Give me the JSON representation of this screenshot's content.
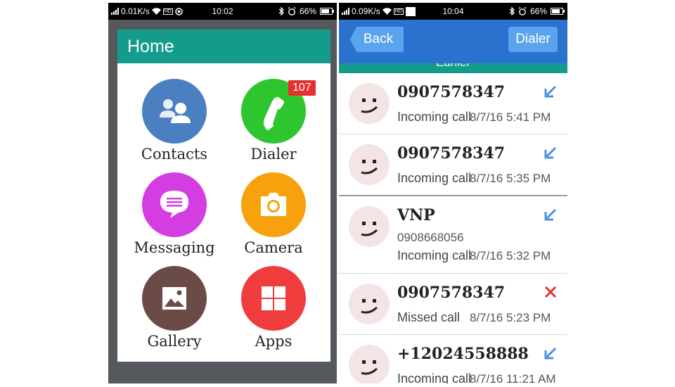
{
  "left_status": {
    "speed": "0.01K/s",
    "time": "10:02",
    "battery": "66%",
    "hd": "HD"
  },
  "right_status": {
    "speed": "0.09K/s",
    "time": "10:04",
    "battery": "66%",
    "hd": "HD"
  },
  "home": {
    "title": "Home",
    "apps": [
      {
        "label": "Contacts",
        "color": "#4a7fc1",
        "icon": "contacts-icon"
      },
      {
        "label": "Dialer",
        "color": "#2ec52e",
        "icon": "phone-icon",
        "badge": "107"
      },
      {
        "label": "Messaging",
        "color": "#d43ee0",
        "icon": "message-icon"
      },
      {
        "label": "Camera",
        "color": "#f7a20c",
        "icon": "camera-icon"
      },
      {
        "label": "Gallery",
        "color": "#6b4b46",
        "icon": "image-icon"
      },
      {
        "label": "Apps",
        "color": "#ef3d3d",
        "icon": "grid-icon"
      }
    ]
  },
  "call_log": {
    "back_label": "Back",
    "dialer_label": "Dialer",
    "section_label": "Earlier",
    "calls": [
      {
        "name": "0907578347",
        "type": "Incoming call",
        "time": "8/7/16 5:41 PM",
        "icon": "incoming-arrow-icon"
      },
      {
        "name": "0907578347",
        "type": "Incoming call",
        "time": "8/7/16 5:35 PM",
        "icon": "incoming-arrow-icon"
      },
      {
        "name": "VNP",
        "number": "0908668056",
        "type": "Incoming call",
        "time": "8/7/16 5:32 PM",
        "icon": "incoming-arrow-icon"
      },
      {
        "name": "0907578347",
        "type": "Missed call",
        "time": "8/7/16 5:23 PM",
        "icon": "missed-call-icon"
      },
      {
        "name": "+12024558888",
        "type": "Incoming call",
        "time": "8/7/16 11:21 AM",
        "icon": "incoming-arrow-icon"
      }
    ]
  },
  "colors": {
    "teal": "#139c8c",
    "blue_bar": "#2b72cf",
    "button_blue": "#5aa4ee",
    "arrow_blue": "#4a90e2",
    "missed_red": "#e62e2e"
  }
}
